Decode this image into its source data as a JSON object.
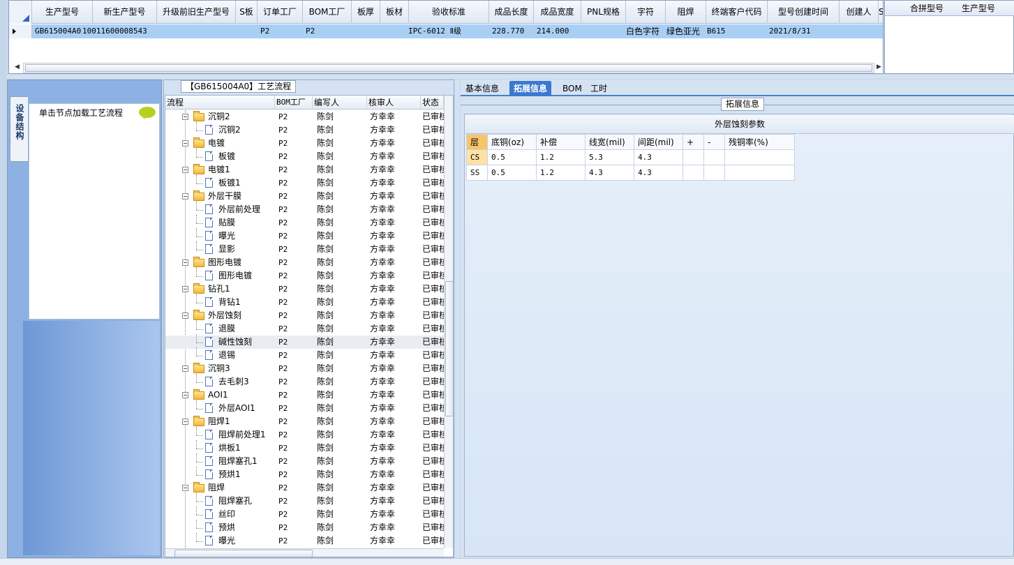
{
  "top_grid": {
    "columns": [
      "生产型号",
      "新生产型号",
      "升级前旧生产型号",
      "S板",
      "订单工厂",
      "BOM工厂",
      "板厚",
      "板材",
      "验收标准",
      "成品长度",
      "成品宽度",
      "PNL规格",
      "字符",
      "阻焊",
      "终端客户代码",
      "型号创建时间",
      "创建人",
      "SO"
    ],
    "row": [
      "GB615004A0",
      "10011600008543",
      "",
      "",
      "P2",
      "P2",
      "",
      "",
      "IPC-6012 Ⅱ级",
      "228.770",
      "214.000",
      "",
      "白色字符",
      "绿色亚光",
      "B615",
      "2021/8/31",
      "",
      ""
    ]
  },
  "right_grid": {
    "columns": [
      "合拼型号",
      "生产型号"
    ]
  },
  "left_panel": {
    "vtab_label": "设备结构",
    "hint": "单击节点加载工艺流程"
  },
  "middle": {
    "title": "【GB615004A0】工艺流程",
    "columns": [
      "流程",
      "BOM工厂",
      "编写人",
      "核审人",
      "状态"
    ],
    "rows": [
      {
        "name": "沉铜2",
        "level": 0,
        "bom": "P2",
        "writer": "陈剑",
        "reviewer": "方幸幸",
        "status": "已审核"
      },
      {
        "name": "沉铜2",
        "level": 1,
        "bom": "P2",
        "writer": "陈剑",
        "reviewer": "方幸幸",
        "status": "已审核"
      },
      {
        "name": "电镀",
        "level": 0,
        "bom": "P2",
        "writer": "陈剑",
        "reviewer": "方幸幸",
        "status": "已审核"
      },
      {
        "name": "板镀",
        "level": 1,
        "bom": "P2",
        "writer": "陈剑",
        "reviewer": "方幸幸",
        "status": "已审核"
      },
      {
        "name": "电镀1",
        "level": 0,
        "bom": "P2",
        "writer": "陈剑",
        "reviewer": "方幸幸",
        "status": "已审核"
      },
      {
        "name": "板镀1",
        "level": 1,
        "bom": "P2",
        "writer": "陈剑",
        "reviewer": "方幸幸",
        "status": "已审核"
      },
      {
        "name": "外层干膜",
        "level": 0,
        "bom": "P2",
        "writer": "陈剑",
        "reviewer": "方幸幸",
        "status": "已审核"
      },
      {
        "name": "外层前处理",
        "level": 1,
        "bom": "P2",
        "writer": "陈剑",
        "reviewer": "方幸幸",
        "status": "已审核"
      },
      {
        "name": "贴膜",
        "level": 1,
        "bom": "P2",
        "writer": "陈剑",
        "reviewer": "方幸幸",
        "status": "已审核"
      },
      {
        "name": "曝光",
        "level": 1,
        "bom": "P2",
        "writer": "陈剑",
        "reviewer": "方幸幸",
        "status": "已审核"
      },
      {
        "name": "显影",
        "level": 1,
        "bom": "P2",
        "writer": "陈剑",
        "reviewer": "方幸幸",
        "status": "已审核"
      },
      {
        "name": "图形电镀",
        "level": 0,
        "bom": "P2",
        "writer": "陈剑",
        "reviewer": "方幸幸",
        "status": "已审核"
      },
      {
        "name": "图形电镀",
        "level": 1,
        "bom": "P2",
        "writer": "陈剑",
        "reviewer": "方幸幸",
        "status": "已审核"
      },
      {
        "name": "钻孔1",
        "level": 0,
        "bom": "P2",
        "writer": "陈剑",
        "reviewer": "方幸幸",
        "status": "已审核"
      },
      {
        "name": "背钻1",
        "level": 1,
        "bom": "P2",
        "writer": "陈剑",
        "reviewer": "方幸幸",
        "status": "已审核"
      },
      {
        "name": "外层蚀刻",
        "level": 0,
        "bom": "P2",
        "writer": "陈剑",
        "reviewer": "方幸幸",
        "status": "已审核"
      },
      {
        "name": "退膜",
        "level": 1,
        "bom": "P2",
        "writer": "陈剑",
        "reviewer": "方幸幸",
        "status": "已审核"
      },
      {
        "name": "碱性蚀刻",
        "level": 1,
        "bom": "P2",
        "writer": "陈剑",
        "reviewer": "方幸幸",
        "status": "已审核",
        "selected": true
      },
      {
        "name": "退锡",
        "level": 1,
        "bom": "P2",
        "writer": "陈剑",
        "reviewer": "方幸幸",
        "status": "已审核"
      },
      {
        "name": "沉铜3",
        "level": 0,
        "bom": "P2",
        "writer": "陈剑",
        "reviewer": "方幸幸",
        "status": "已审核"
      },
      {
        "name": "去毛刺3",
        "level": 1,
        "bom": "P2",
        "writer": "陈剑",
        "reviewer": "方幸幸",
        "status": "已审核"
      },
      {
        "name": "AOI1",
        "level": 0,
        "bom": "P2",
        "writer": "陈剑",
        "reviewer": "方幸幸",
        "status": "已审核"
      },
      {
        "name": "外层AOI1",
        "level": 1,
        "bom": "P2",
        "writer": "陈剑",
        "reviewer": "方幸幸",
        "status": "已审核"
      },
      {
        "name": "阻焊1",
        "level": 0,
        "bom": "P2",
        "writer": "陈剑",
        "reviewer": "方幸幸",
        "status": "已审核"
      },
      {
        "name": "阻焊前处理1",
        "level": 1,
        "bom": "P2",
        "writer": "陈剑",
        "reviewer": "方幸幸",
        "status": "已审核"
      },
      {
        "name": "烘板1",
        "level": 1,
        "bom": "P2",
        "writer": "陈剑",
        "reviewer": "方幸幸",
        "status": "已审核"
      },
      {
        "name": "阻焊塞孔1",
        "level": 1,
        "bom": "P2",
        "writer": "陈剑",
        "reviewer": "方幸幸",
        "status": "已审核"
      },
      {
        "name": "预烘1",
        "level": 1,
        "bom": "P2",
        "writer": "陈剑",
        "reviewer": "方幸幸",
        "status": "已审核"
      },
      {
        "name": "阻焊",
        "level": 0,
        "bom": "P2",
        "writer": "陈剑",
        "reviewer": "方幸幸",
        "status": "已审核"
      },
      {
        "name": "阻焊塞孔",
        "level": 1,
        "bom": "P2",
        "writer": "陈剑",
        "reviewer": "方幸幸",
        "status": "已审核"
      },
      {
        "name": "丝印",
        "level": 1,
        "bom": "P2",
        "writer": "陈剑",
        "reviewer": "方幸幸",
        "status": "已审核"
      },
      {
        "name": "预烘",
        "level": 1,
        "bom": "P2",
        "writer": "陈剑",
        "reviewer": "方幸幸",
        "status": "已审核"
      },
      {
        "name": "曝光",
        "level": 1,
        "bom": "P2",
        "writer": "陈剑",
        "reviewer": "方幸幸",
        "status": "已审核"
      }
    ]
  },
  "right": {
    "tabs": [
      "基本信息",
      "拓展信息",
      "BOM",
      "工时"
    ],
    "active_tab": "拓展信息",
    "section_title": "拓展信息",
    "table_title": "外层蚀刻参数",
    "columns": [
      "层",
      "底铜(oz)",
      "补偿",
      "线宽(mil)",
      "间距(mil)",
      "+",
      "-",
      "残铜率(%)"
    ],
    "rows": [
      [
        "CS",
        "0.5",
        "1.2",
        "5.3",
        "4.3",
        "",
        "",
        ""
      ],
      [
        "SS",
        "0.5",
        "1.2",
        "4.3",
        "4.3",
        "",
        "",
        ""
      ]
    ]
  },
  "colors": {
    "selected_row": "#a9cff5",
    "active_tab": "#3b78cf",
    "highlight_header": "#f7c66a",
    "folder": "#f2b83a"
  }
}
